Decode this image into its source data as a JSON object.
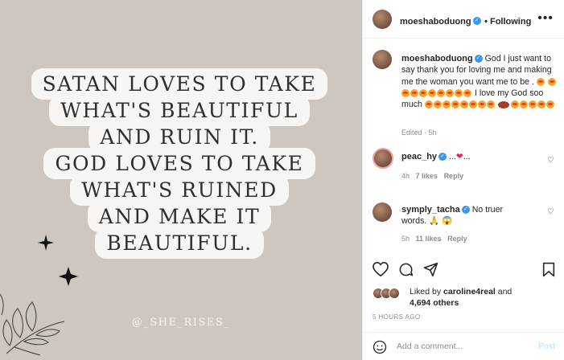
{
  "image": {
    "quote_lines": [
      "SATAN LOVES TO TAKE",
      "WHAT'S BEAUTIFUL",
      "AND RUIN IT.",
      "GOD LOVES TO TAKE",
      "WHAT'S RUINED",
      "AND MAKE IT",
      "BEAUTIFUL."
    ],
    "handle": "@_SHE_RISES_"
  },
  "header": {
    "username": "moeshaboduong",
    "follow_label": "• Following",
    "more": "•••"
  },
  "caption": {
    "username": "moeshaboduong",
    "text_1": "God I just want to say thank you for loving me and making me the woman you want me to be .",
    "text_2": "I love my God soo much",
    "meta": "Edited · 5h"
  },
  "comments": [
    {
      "username": "peac_hy",
      "text": "...",
      "text_end": "...",
      "time": "4h",
      "likes": "7 likes",
      "reply": "Reply"
    },
    {
      "username": "symply_tacha",
      "text": "No truer words.",
      "time": "5h",
      "likes": "11 likes",
      "reply": "Reply"
    }
  ],
  "likes": {
    "prefix": "Liked by ",
    "user": "caroline4real",
    "suffix": " and",
    "others": "4,694 others"
  },
  "timestamp": "5 HOURS AGO",
  "comment_box": {
    "placeholder": "Add a comment...",
    "post_label": "Post"
  },
  "colors": {
    "image_bg": "#cec7bf",
    "verified": "#3897f0",
    "post_disabled": "#b2dffc"
  }
}
